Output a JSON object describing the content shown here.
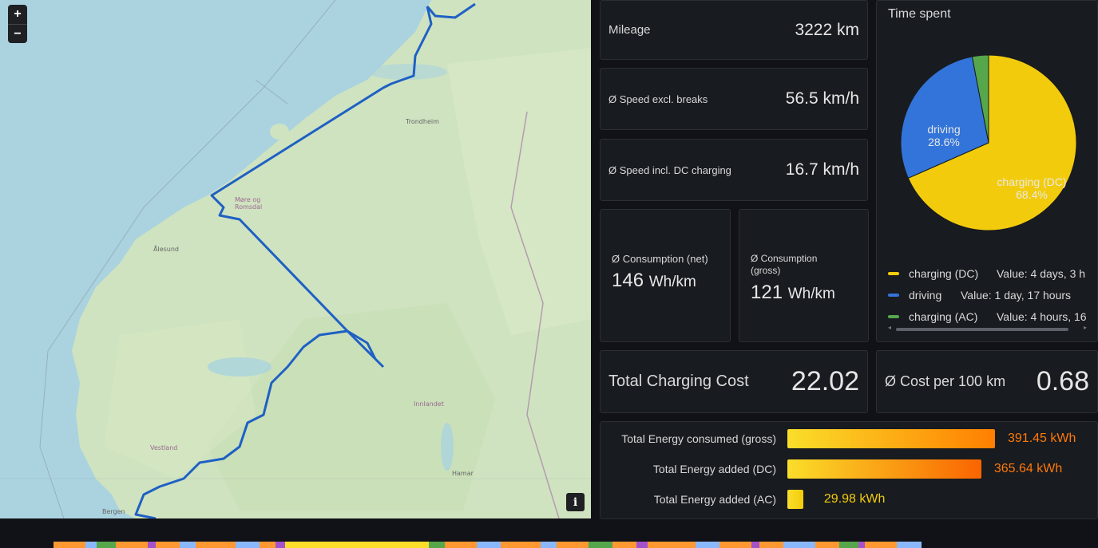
{
  "map": {
    "zoom_in": "+",
    "zoom_out": "−",
    "info": "i",
    "labels": [
      "Trondheim",
      "Møre og Romsdal",
      "Ålesund",
      "Innlandet",
      "Vestland",
      "Hamar",
      "Bergen"
    ]
  },
  "stats": {
    "mileage": {
      "label": "Mileage",
      "value": "3222 km"
    },
    "speed_excl": {
      "label": "Ø Speed excl. breaks",
      "value": "56.5 km/h"
    },
    "speed_incl": {
      "label": "Ø Speed incl. DC charging",
      "value": "16.7 km/h"
    },
    "cons_net": {
      "label": "Ø Consumption (net)",
      "value": "146",
      "unit": "Wh/km"
    },
    "cons_gross": {
      "label": "Ø Consumption (gross)",
      "value": "121",
      "unit": "Wh/km"
    },
    "total_cost": {
      "label": "Total Charging Cost",
      "value": "22.02"
    },
    "cost_100": {
      "label": "Ø Cost per 100 km",
      "value": "0.68"
    }
  },
  "time_spent": {
    "title": "Time spent",
    "legend": [
      {
        "name": "charging (DC)",
        "value": "Value: 4 days, 3 h",
        "color": "#f2cc0c"
      },
      {
        "name": "driving",
        "value": "Value: 1 day, 17 hours",
        "color": "#3274d9"
      },
      {
        "name": "charging (AC)",
        "value": "Value: 4 hours, 16",
        "color": "#56a64b"
      }
    ],
    "slice_labels": {
      "driving": "driving",
      "driving_pct": "28.6%",
      "dc": "charging (DC)",
      "dc_pct": "68.4%"
    }
  },
  "chart_data": {
    "type": "pie",
    "categories": [
      "charging (DC)",
      "driving",
      "charging (AC)"
    ],
    "values": [
      68.4,
      28.6,
      3.0
    ],
    "colors": [
      "#f2cc0c",
      "#3274d9",
      "#56a64b"
    ],
    "title": "Time spent"
  },
  "energy": {
    "rows": [
      {
        "label": "Total Energy consumed (gross)",
        "value": "391.45",
        "unit": "kWh",
        "amount": 391.45
      },
      {
        "label": "Total Energy added (DC)",
        "value": "365.64",
        "unit": "kWh",
        "amount": 365.64
      },
      {
        "label": "Total Energy added (AC)",
        "value": "29.98",
        "unit": "kWh",
        "amount": 29.98
      }
    ],
    "max": 391.45
  }
}
